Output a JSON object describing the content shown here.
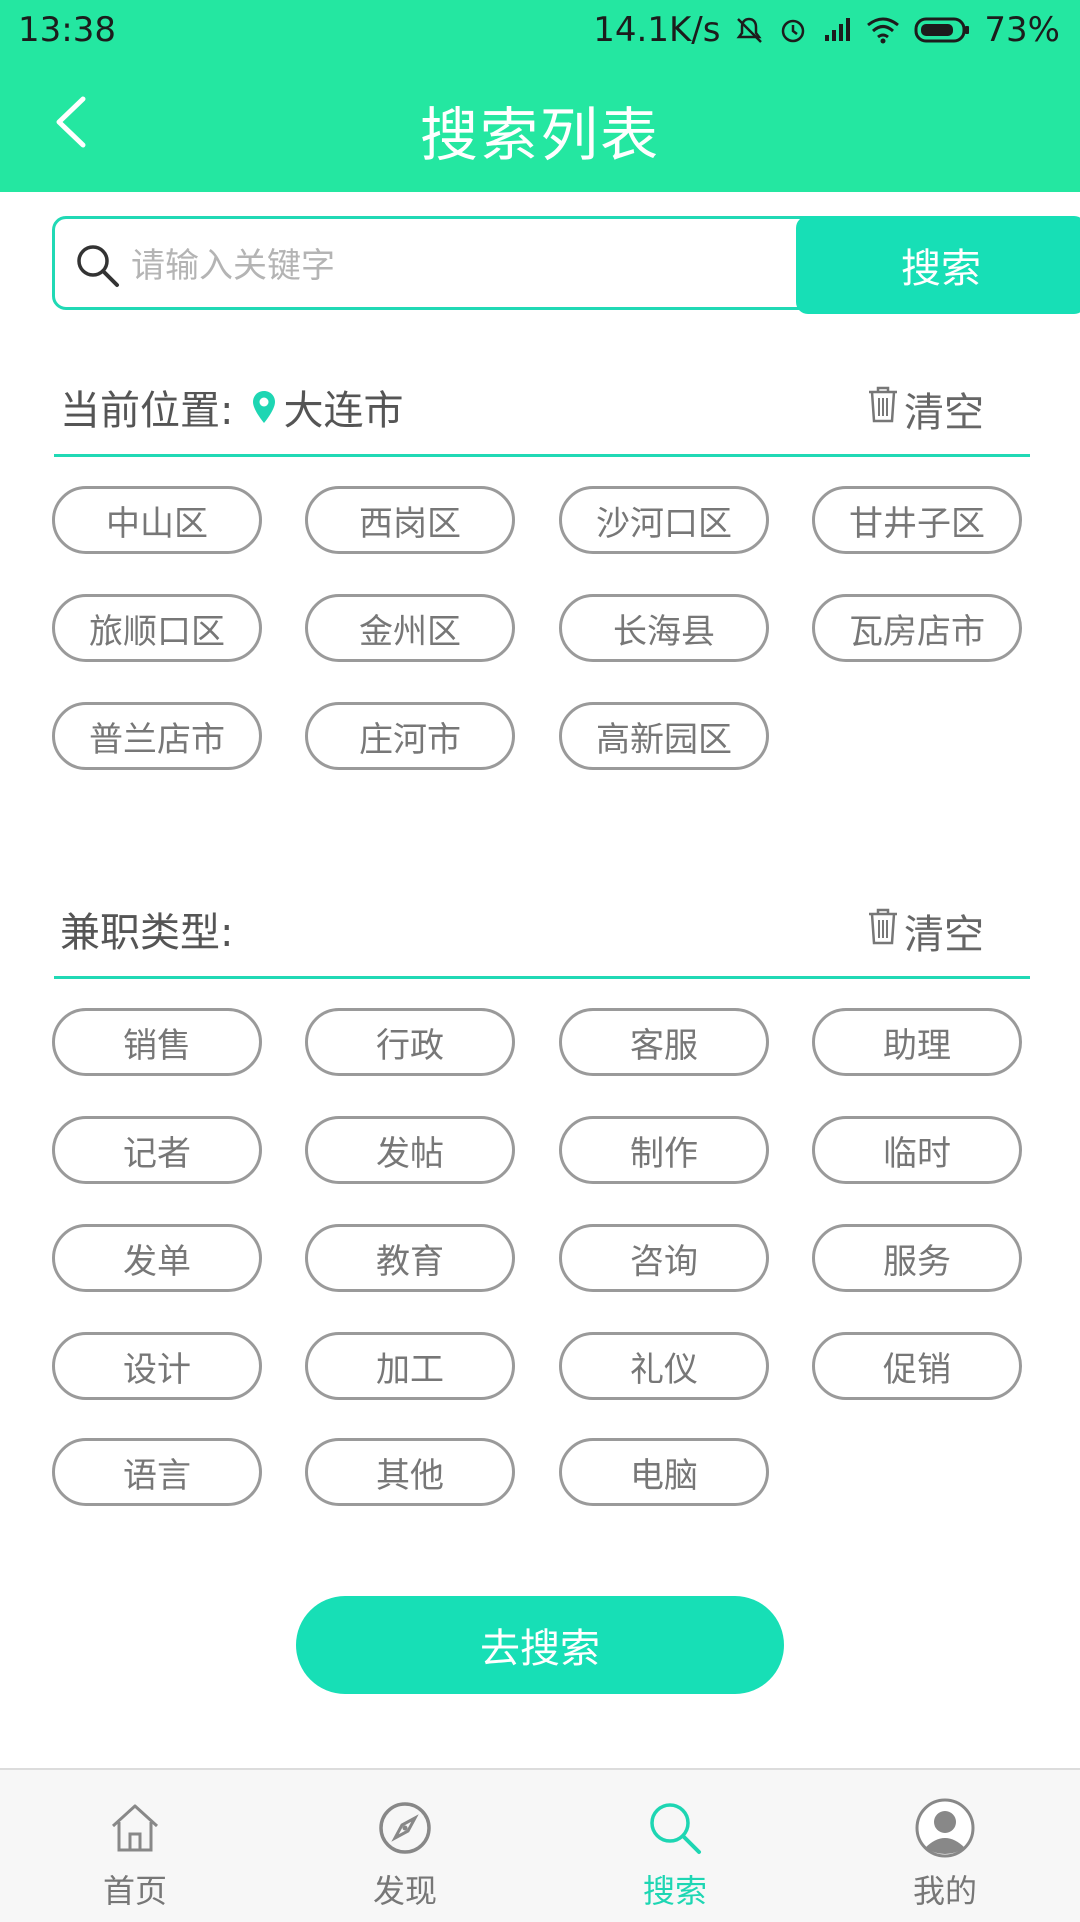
{
  "status_bar": {
    "time": "13:38",
    "network_speed": "14.1K/s",
    "battery": "73%"
  },
  "header": {
    "title": "搜索列表",
    "back_icon": "chevron-left-icon"
  },
  "search": {
    "placeholder": "请输入关键字",
    "value": "",
    "button_label": "搜索"
  },
  "location_section": {
    "label": "当前位置:",
    "city": "大连市",
    "clear_label": "清空",
    "districts": [
      "中山区",
      "西岗区",
      "沙河口区",
      "甘井子区",
      "旅顺口区",
      "金州区",
      "长海县",
      "瓦房店市",
      "普兰店市",
      "庄河市",
      "高新园区"
    ]
  },
  "job_type_section": {
    "label": "兼职类型:",
    "clear_label": "清空",
    "types": [
      "销售",
      "行政",
      "客服",
      "助理",
      "记者",
      "发帖",
      "制作",
      "临时",
      "发单",
      "教育",
      "咨询",
      "服务",
      "设计",
      "加工",
      "礼仪",
      "促销",
      "语言",
      "其他",
      "电脑"
    ]
  },
  "go_search_label": "去搜索",
  "tabbar": {
    "items": [
      {
        "label": "首页",
        "icon": "home-icon"
      },
      {
        "label": "发现",
        "icon": "compass-icon"
      },
      {
        "label": "搜索",
        "icon": "search-icon",
        "active": true
      },
      {
        "label": "我的",
        "icon": "user-icon"
      }
    ]
  },
  "colors": {
    "header_bg": "#24e7a1",
    "accent": "#17dfb6",
    "chip_border": "#9a9a9a"
  }
}
